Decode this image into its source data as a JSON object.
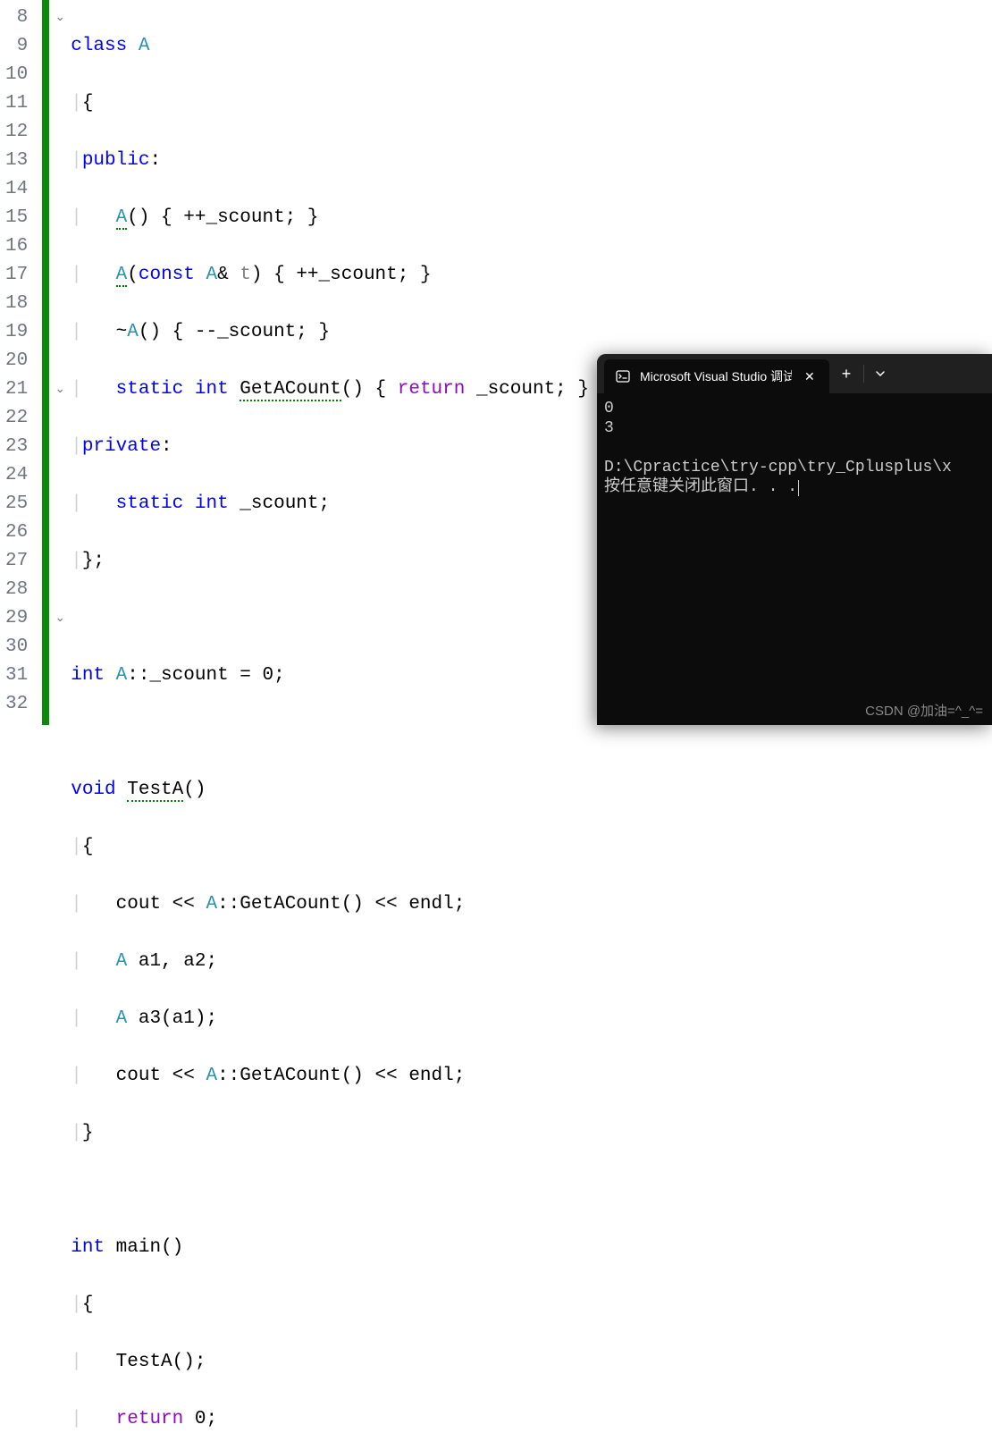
{
  "editor": {
    "line_numbers": [
      "8",
      "9",
      "10",
      "11",
      "12",
      "13",
      "14",
      "15",
      "16",
      "17",
      "18",
      "19",
      "20",
      "21",
      "22",
      "23",
      "24",
      "25",
      "26",
      "27",
      "28",
      "29",
      "30",
      "31",
      "32"
    ],
    "fold_rows": {
      "0": "⌄",
      "13": "⌄",
      "21": "⌄"
    },
    "code": {
      "l8": {
        "kw": "class",
        "sp": " ",
        "cls": "A"
      },
      "l9": {
        "brace": "{"
      },
      "l10": {
        "kw": "public",
        "colon": ":"
      },
      "l11": {
        "cls": "A",
        "rest": "() { ++_scount; }"
      },
      "l12": {
        "cls": "A",
        "p1": "(",
        "kw": "const",
        "sp": " ",
        "cls2": "A",
        "amp": "& ",
        "t": "t",
        "rest": ") { ++_scount; }"
      },
      "l13": {
        "tilde": "~",
        "cls": "A",
        "rest": "() { --_scount; }"
      },
      "l14": {
        "kw1": "static",
        "sp1": " ",
        "kw2": "int",
        "sp2": " ",
        "fn": "GetACount",
        "rest1": "() { ",
        "ret": "return",
        "rest2": " _scount; }"
      },
      "l15": {
        "kw": "private",
        "colon": ":"
      },
      "l16": {
        "kw1": "static",
        "sp1": " ",
        "kw2": "int",
        "rest": " _scount;"
      },
      "l17": {
        "brace": "};"
      },
      "l19": {
        "kw": "int",
        "sp": " ",
        "cls": "A",
        "rest": "::_scount = 0;"
      },
      "l21": {
        "kw": "void",
        "sp": " ",
        "fn": "TestA",
        "rest": "()"
      },
      "l22": {
        "brace": "{"
      },
      "l23": {
        "pre": "cout << ",
        "cls": "A",
        "rest": "::GetACount() << endl;"
      },
      "l24": {
        "cls": "A",
        "rest": " a1, a2;"
      },
      "l25": {
        "cls": "A",
        "rest": " a3(a1);"
      },
      "l26": {
        "pre": "cout << ",
        "cls": "A",
        "rest": "::GetACount() << endl;"
      },
      "l27": {
        "brace": "}"
      },
      "l29": {
        "kw": "int",
        "sp": " ",
        "fn": "main",
        "rest": "()"
      },
      "l30": {
        "brace": "{"
      },
      "l31": {
        "fn": "TestA();"
      },
      "l32": {
        "ret": "return",
        "rest": " 0;"
      }
    }
  },
  "console": {
    "tab_title": "Microsoft Visual Studio 调试",
    "output_line1": "0",
    "output_line2": "3",
    "path_line": "D:\\Cpractice\\try-cpp\\try_Cplusplus\\x",
    "prompt_line": "按任意键关闭此窗口. . ."
  },
  "watermark": "CSDN @加油=^_^="
}
